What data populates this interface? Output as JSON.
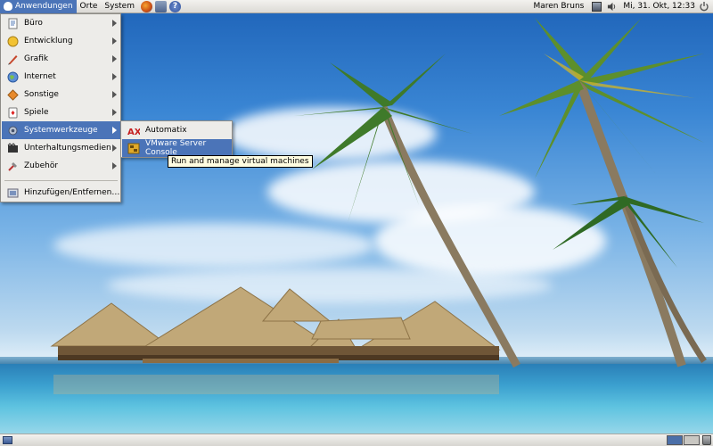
{
  "top_panel": {
    "menus": [
      {
        "label": "Anwendungen",
        "active": true
      },
      {
        "label": "Orte"
      },
      {
        "label": "System"
      }
    ],
    "launchers": [
      "firefox-icon",
      "mail-icon",
      "help-icon"
    ],
    "user_name": "Maren Bruns",
    "clock": "Mi, 31. Okt, 12:33",
    "tray_icons": [
      "network-icon",
      "volume-icon",
      "power-icon"
    ]
  },
  "apps_menu": {
    "items": [
      {
        "label": "Büro",
        "icon": "office-icon",
        "has_submenu": true
      },
      {
        "label": "Entwicklung",
        "icon": "development-icon",
        "has_submenu": true
      },
      {
        "label": "Grafik",
        "icon": "graphics-icon",
        "has_submenu": true
      },
      {
        "label": "Internet",
        "icon": "internet-icon",
        "has_submenu": true
      },
      {
        "label": "Sonstige",
        "icon": "other-icon",
        "has_submenu": true
      },
      {
        "label": "Spiele",
        "icon": "games-icon",
        "has_submenu": true
      },
      {
        "label": "Systemwerkzeuge",
        "icon": "system-tools-icon",
        "has_submenu": true,
        "highlighted": true
      },
      {
        "label": "Unterhaltungsmedien",
        "icon": "multimedia-icon",
        "has_submenu": true
      },
      {
        "label": "Zubehör",
        "icon": "accessories-icon",
        "has_submenu": true
      },
      {
        "label": "Hinzufügen/Entfernen ...",
        "icon": "add-remove-icon",
        "has_submenu": false
      }
    ]
  },
  "system_tools_submenu": {
    "items": [
      {
        "label": "Automatix",
        "icon": "automatix-icon"
      },
      {
        "label": "VMware Server Console",
        "icon": "vmware-icon",
        "highlighted": true
      }
    ]
  },
  "tooltip": "Run and manage virtual machines",
  "bottom_panel": {
    "workspaces": [
      "workspace-1",
      "workspace-2"
    ],
    "active_workspace": 1
  },
  "colors": {
    "highlight": "#4b74b8",
    "panel": "#e6e4e0",
    "tooltip_bg": "#fffde1"
  }
}
